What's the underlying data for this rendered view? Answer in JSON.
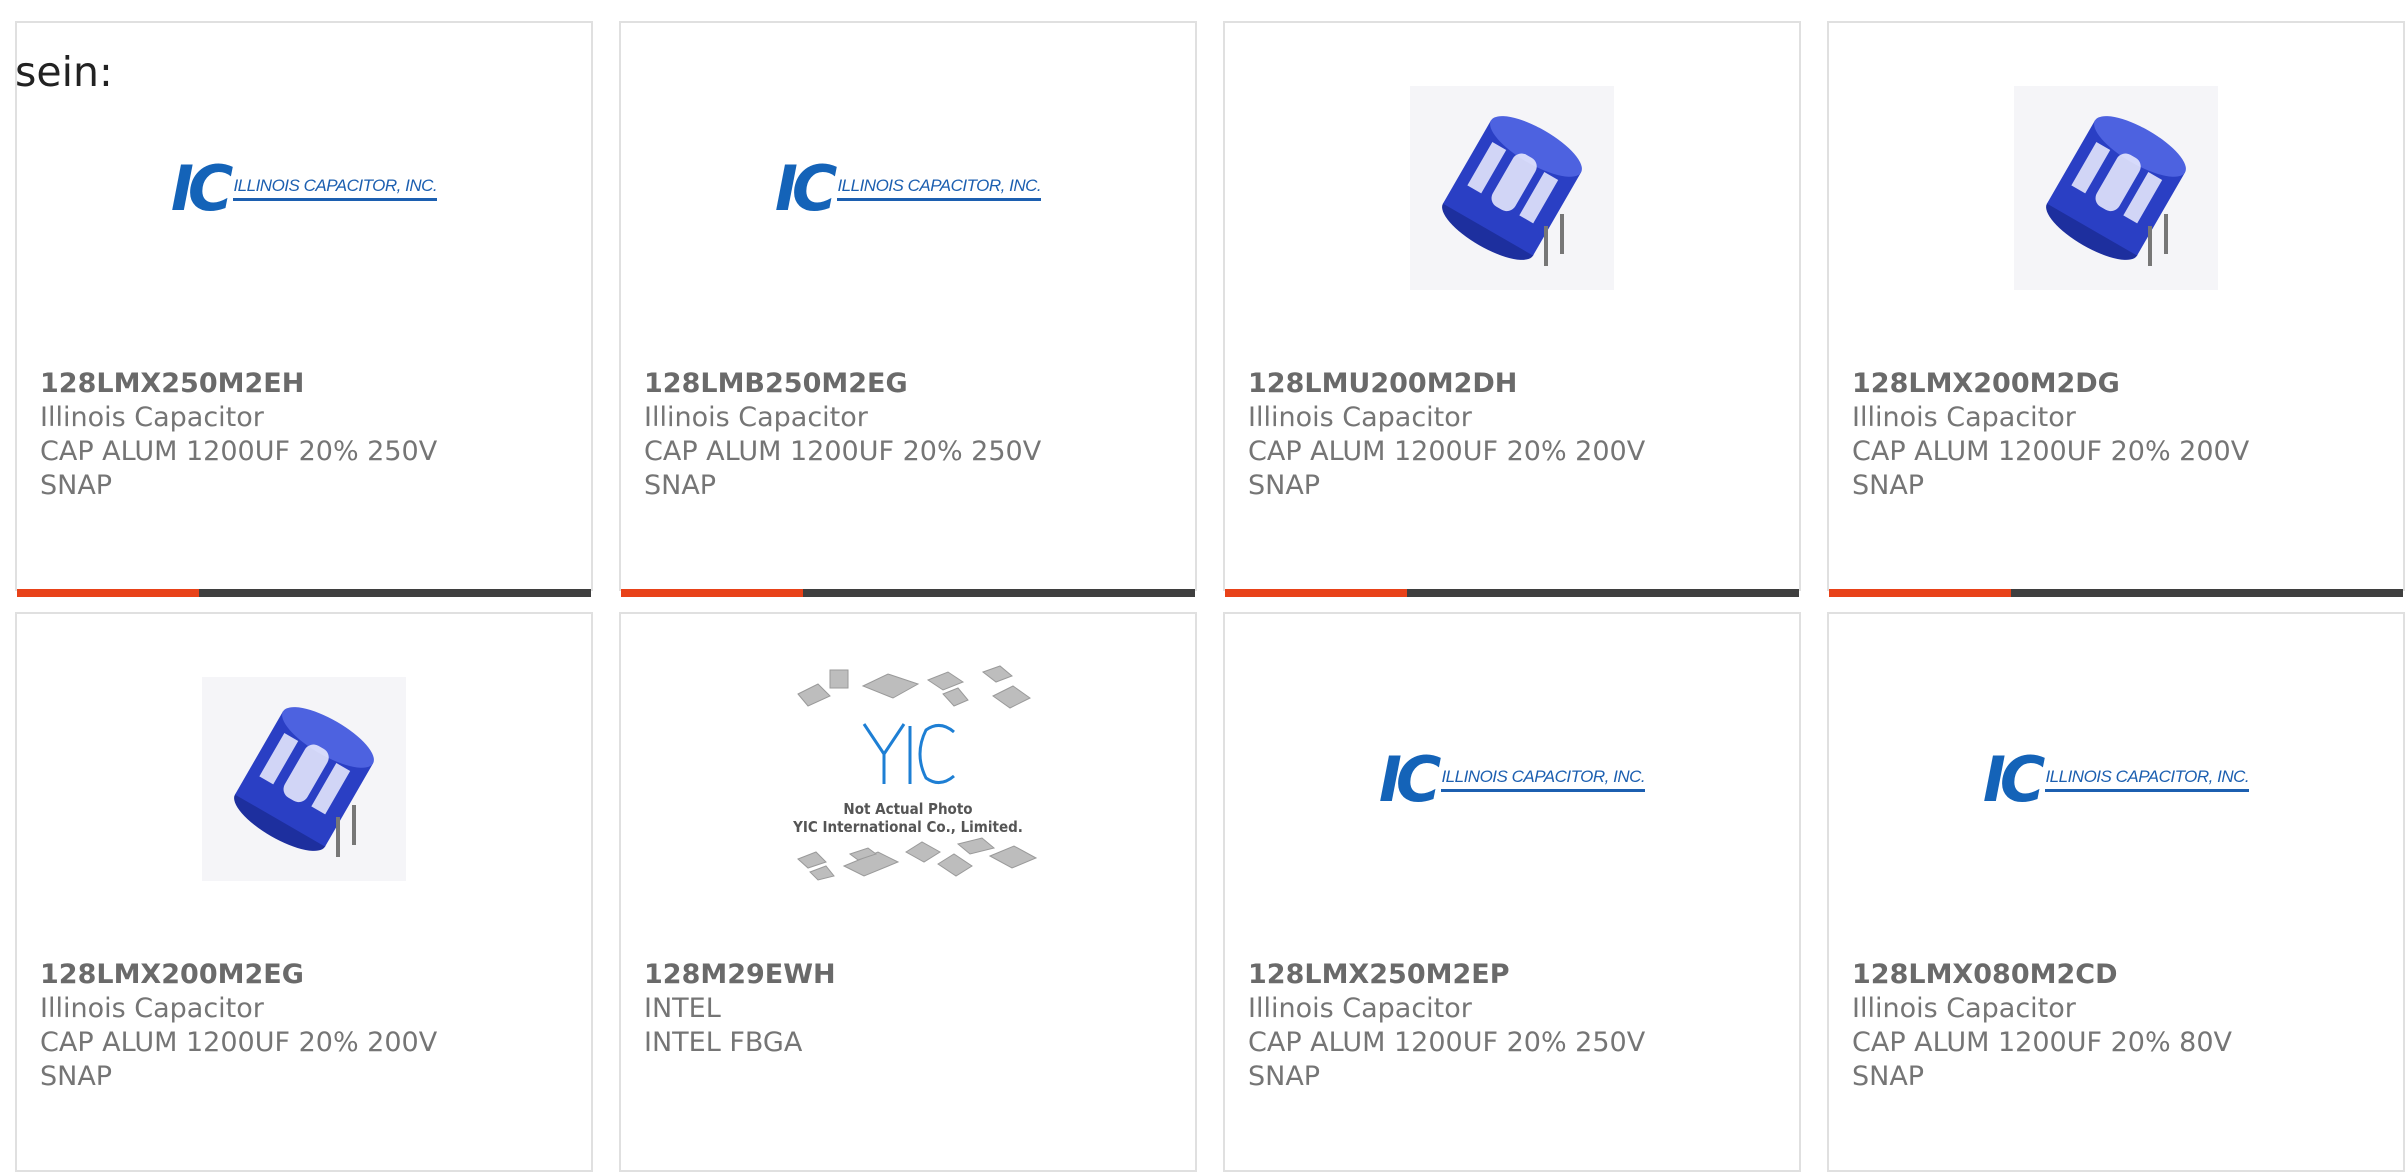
{
  "intro_text": "sein:",
  "colors": {
    "accent": "#e84219",
    "bar": "#3f3f3f",
    "border": "#e0e0e0",
    "text": "#757575",
    "ic_blue": "#1463b8"
  },
  "products": [
    {
      "part": "128LMX250M2EH",
      "maker": "Illinois Capacitor",
      "desc": "CAP ALUM 1200UF 20% 250V",
      "desc2": "SNAP",
      "image": "ic-logo",
      "logo_mark": "IC",
      "logo_text": "ILLINOIS CAPACITOR, INC."
    },
    {
      "part": "128LMB250M2EG",
      "maker": "Illinois Capacitor",
      "desc": "CAP ALUM 1200UF 20% 250V",
      "desc2": "SNAP",
      "image": "ic-logo",
      "logo_mark": "IC",
      "logo_text": "ILLINOIS CAPACITOR, INC."
    },
    {
      "part": "128LMU200M2DH",
      "maker": "Illinois Capacitor",
      "desc": "CAP ALUM 1200UF 20% 200V",
      "desc2": "SNAP",
      "image": "capacitor"
    },
    {
      "part": "128LMX200M2DG",
      "maker": "Illinois Capacitor",
      "desc": "CAP ALUM 1200UF 20% 200V",
      "desc2": "SNAP",
      "image": "capacitor"
    },
    {
      "part": "128LMX200M2EG",
      "maker": "Illinois Capacitor",
      "desc": "CAP ALUM 1200UF 20% 200V",
      "desc2": "SNAP",
      "image": "capacitor"
    },
    {
      "part": "128M29EWH",
      "maker": "INTEL",
      "desc": "INTEL FBGA",
      "desc2": "",
      "image": "yic",
      "yic_line1": "Not Actual Photo",
      "yic_line2": "YIC International Co., Limited."
    },
    {
      "part": "128LMX250M2EP",
      "maker": "Illinois Capacitor",
      "desc": "CAP ALUM 1200UF 20% 250V",
      "desc2": "SNAP",
      "image": "ic-logo",
      "logo_mark": "IC",
      "logo_text": "ILLINOIS CAPACITOR, INC."
    },
    {
      "part": "128LMX080M2CD",
      "maker": "Illinois Capacitor",
      "desc": "CAP ALUM 1200UF 20% 80V",
      "desc2": "SNAP",
      "image": "ic-logo",
      "logo_mark": "IC",
      "logo_text": "ILLINOIS CAPACITOR, INC."
    }
  ]
}
